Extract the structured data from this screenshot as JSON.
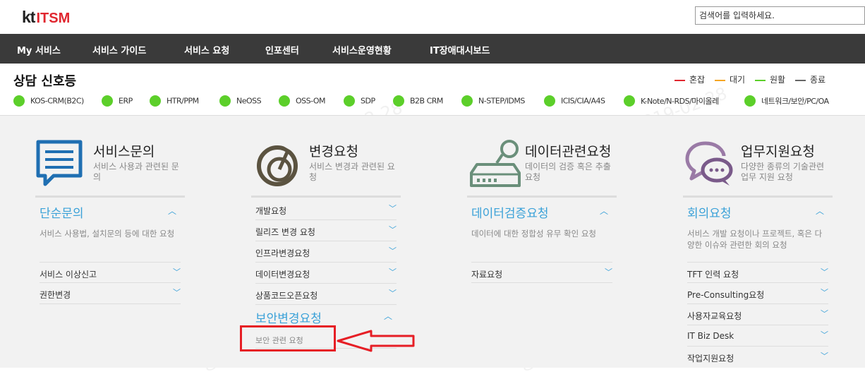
{
  "header": {
    "logo_kt": "kt",
    "logo_itsm": "ITSM",
    "search_placeholder": "검색어를 입력하세요."
  },
  "nav": [
    "My 서비스",
    "서비스 가이드",
    "서비스 요청",
    "인포센터",
    "서비스운영현황",
    "IT장애대시보드"
  ],
  "status": {
    "title": "상담 신호등",
    "legend": [
      {
        "label": "혼잡",
        "color": "#e0262f"
      },
      {
        "label": "대기",
        "color": "#f5a623"
      },
      {
        "label": "원활",
        "color": "#5ccf2a"
      },
      {
        "label": "종료",
        "color": "#666666"
      }
    ],
    "systems": [
      "KOS-CRM(B2C)",
      "ERP",
      "HTR/PPM",
      "NeOSS",
      "OSS-OM",
      "SDP",
      "B2B CRM",
      "N-STEP/IDMS",
      "ICIS/CIA/A4S",
      "K-Note/N-RDS/마이올레",
      "네트워크/보안/PC/OA"
    ],
    "system_status_color": "#5ccf2a"
  },
  "categories": [
    {
      "title": "서비스문의",
      "desc": "서비스 사용과 관련된 문의",
      "icon": "chat-document-icon",
      "section": {
        "title": "단순문의",
        "desc": "서비스 사용법, 설치문의 등에 대한 요청"
      },
      "items": [
        "서비스 이상신고",
        "권한변경"
      ]
    },
    {
      "title": "변경요청",
      "desc": "서비스 변경과 관련된 요청",
      "icon": "dial-icon",
      "items_top": [
        "개발요청",
        "릴리즈 변경 요청",
        "인프라변경요청",
        "데이터변경요청",
        "상품코드오픈요청"
      ],
      "section": {
        "title": "보안변경요청",
        "sub": "보안 관련 요청"
      }
    },
    {
      "title": "데이터관련요청",
      "desc": "데이터의 검증 혹은 추출 요청",
      "icon": "database-icon",
      "section": {
        "title": "데이터검증요청",
        "desc": "데이터에 대한 정합성 유무 확인 요청"
      },
      "items": [
        "자료요청"
      ]
    },
    {
      "title": "업무지원요청",
      "desc": "다양한 종류의 기술관련 업무 지원 요청",
      "icon": "speech-bubbles-icon",
      "section": {
        "title": "회의요청",
        "desc": "서비스 개발 요청이나 프로젝트, 혹은 다양한 이슈와 관련한 회의 요청"
      },
      "items": [
        "TFT 인력 요청",
        "Pre-Consulting요청",
        "사용자교육요청",
        "IT Biz Desk",
        "작업지원요청"
      ]
    }
  ],
  "watermark": [
    "강대훈 91222977 2019-02-28"
  ],
  "colors": {
    "accent": "#3aa1d8",
    "nav_bg": "#3a3a3a",
    "annotation": "#e61e25"
  }
}
